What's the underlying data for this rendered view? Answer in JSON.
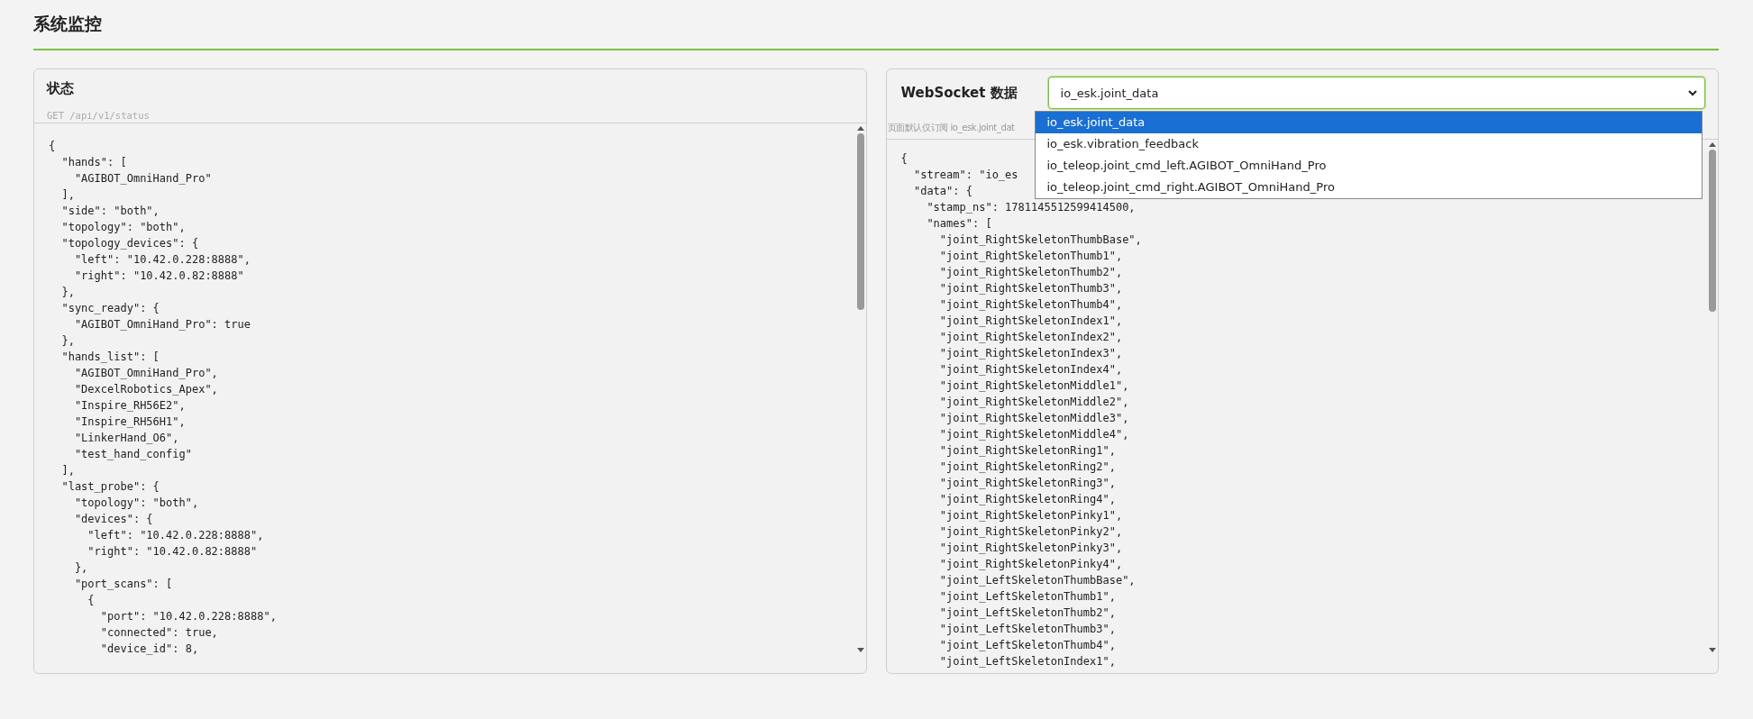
{
  "page": {
    "title": "系统监控"
  },
  "panels": [
    {
      "kind": "status",
      "title": "状态",
      "endpoint": "GET /api/v1/status",
      "code_lines": [
        "{",
        "  \"hands\": [",
        "    \"AGIBOT_OmniHand_Pro\"",
        "  ],",
        "  \"side\": \"both\",",
        "  \"topology\": \"both\",",
        "  \"topology_devices\": {",
        "    \"left\": \"10.42.0.228:8888\",",
        "    \"right\": \"10.42.0.82:8888\"",
        "  },",
        "  \"sync_ready\": {",
        "    \"AGIBOT_OmniHand_Pro\": true",
        "  },",
        "  \"hands_list\": [",
        "    \"AGIBOT_OmniHand_Pro\",",
        "    \"DexcelRobotics_Apex\",",
        "    \"Inspire_RH56E2\",",
        "    \"Inspire_RH56H1\",",
        "    \"LinkerHand_O6\",",
        "    \"test_hand_config\"",
        "  ],",
        "  \"last_probe\": {",
        "    \"topology\": \"both\",",
        "    \"devices\": {",
        "      \"left\": \"10.42.0.228:8888\",",
        "      \"right\": \"10.42.0.82:8888\"",
        "    },",
        "    \"port_scans\": [",
        "      {",
        "        \"port\": \"10.42.0.228:8888\",",
        "        \"connected\": true,",
        "        \"device_id\": 8,"
      ]
    },
    {
      "kind": "websocket",
      "title": "WebSocket 数据",
      "select": {
        "value": "io_esk.joint_data",
        "expanded": true,
        "options": [
          {
            "label": "io_esk.joint_data",
            "selected": true
          },
          {
            "label": "io_esk.vibration_feedback",
            "selected": false
          },
          {
            "label": "io_teleop.joint_cmd_left.AGIBOT_OmniHand_Pro",
            "selected": false
          },
          {
            "label": "io_teleop.joint_cmd_right.AGIBOT_OmniHand_Pro",
            "selected": false
          }
        ]
      },
      "note": "页面默认仅订阅 io_esk.joint_dat",
      "code_lines": [
        "{",
        "  \"stream\": \"io_es",
        "  \"data\": {",
        "    \"stamp_ns\": 1781145512599414500,",
        "    \"names\": [",
        "      \"joint_RightSkeletonThumbBase\",",
        "      \"joint_RightSkeletonThumb1\",",
        "      \"joint_RightSkeletonThumb2\",",
        "      \"joint_RightSkeletonThumb3\",",
        "      \"joint_RightSkeletonThumb4\",",
        "      \"joint_RightSkeletonIndex1\",",
        "      \"joint_RightSkeletonIndex2\",",
        "      \"joint_RightSkeletonIndex3\",",
        "      \"joint_RightSkeletonIndex4\",",
        "      \"joint_RightSkeletonMiddle1\",",
        "      \"joint_RightSkeletonMiddle2\",",
        "      \"joint_RightSkeletonMiddle3\",",
        "      \"joint_RightSkeletonMiddle4\",",
        "      \"joint_RightSkeletonRing1\",",
        "      \"joint_RightSkeletonRing2\",",
        "      \"joint_RightSkeletonRing3\",",
        "      \"joint_RightSkeletonRing4\",",
        "      \"joint_RightSkeletonPinky1\",",
        "      \"joint_RightSkeletonPinky2\",",
        "      \"joint_RightSkeletonPinky3\",",
        "      \"joint_RightSkeletonPinky4\",",
        "      \"joint_LeftSkeletonThumbBase\",",
        "      \"joint_LeftSkeletonThumb1\",",
        "      \"joint_LeftSkeletonThumb2\",",
        "      \"joint_LeftSkeletonThumb3\",",
        "      \"joint_LeftSkeletonThumb4\",",
        "      \"joint_LeftSkeletonIndex1\","
      ]
    }
  ]
}
